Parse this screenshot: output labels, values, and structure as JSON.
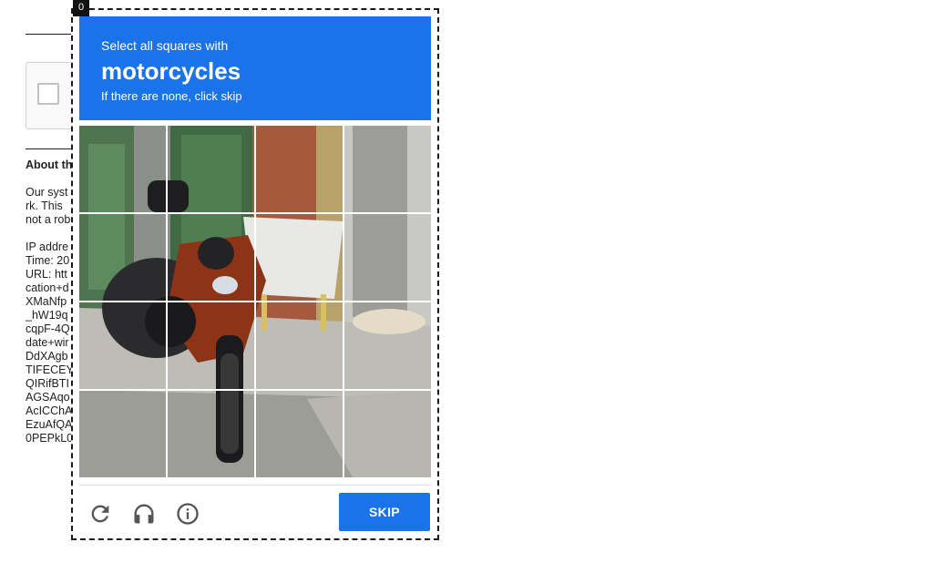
{
  "background": {
    "about_heading": "About th",
    "paragraph": "Our syst\nrk. This \nnot a rob",
    "details": [
      "IP addre",
      "Time: 20",
      "URL: htt",
      "cation+d",
      "XMaNfp",
      "_hW19q",
      "cqpF-4Q",
      "date+wir",
      "DdXAgb",
      "TIFECEY",
      "QIRifBTI",
      "AGSAqo",
      "AcICChA",
      "EzuAfQA",
      "0PEPkL0"
    ]
  },
  "popup": {
    "tag": "0",
    "instruction_line1": "Select all squares with",
    "keyword": "motorcycles",
    "instruction_line2": "If there are none, click skip",
    "grid_size": "4x4",
    "controls": {
      "reload_icon": "reload-icon",
      "audio_icon": "headphones-icon",
      "info_icon": "info-icon",
      "skip_label": "SKIP"
    },
    "colors": {
      "accent": "#1a73e8",
      "icon": "#555555"
    }
  }
}
